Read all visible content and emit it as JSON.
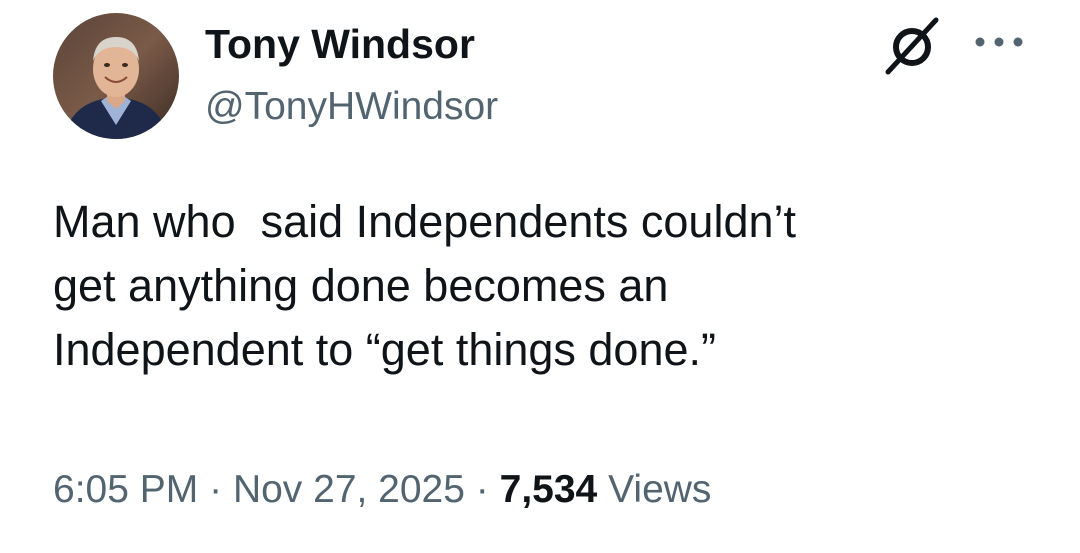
{
  "author": {
    "name": "Tony Windsor",
    "handle": "@TonyHWindsor"
  },
  "icons": {
    "grok": "grok-slash-icon",
    "more": "more-dots-icon"
  },
  "tweet": {
    "text": "Man who  said Independents couldn’t\nget anything done becomes an\nIndependent to “get things done.”"
  },
  "meta": {
    "time": "6:05 PM",
    "separator": "·",
    "date": "Nov 27, 2025",
    "views_count": "7,534",
    "views_label": "Views"
  },
  "colors": {
    "text_primary": "#0f1419",
    "text_secondary": "#536471",
    "background": "#ffffff"
  }
}
